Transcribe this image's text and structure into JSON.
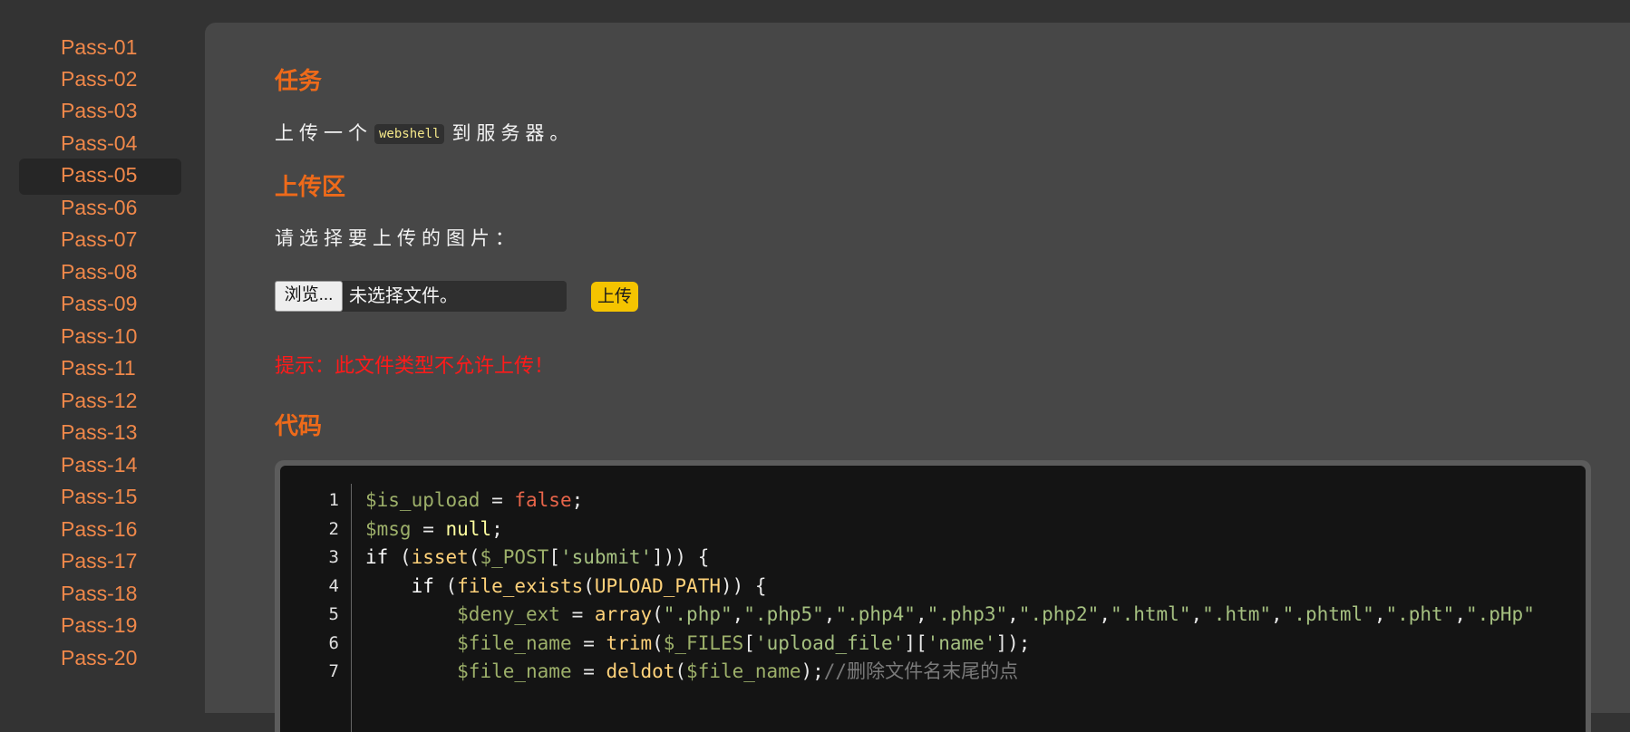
{
  "sidebar": {
    "items": [
      {
        "label": "Pass-01",
        "active": false
      },
      {
        "label": "Pass-02",
        "active": false
      },
      {
        "label": "Pass-03",
        "active": false
      },
      {
        "label": "Pass-04",
        "active": false
      },
      {
        "label": "Pass-05",
        "active": true
      },
      {
        "label": "Pass-06",
        "active": false
      },
      {
        "label": "Pass-07",
        "active": false
      },
      {
        "label": "Pass-08",
        "active": false
      },
      {
        "label": "Pass-09",
        "active": false
      },
      {
        "label": "Pass-10",
        "active": false
      },
      {
        "label": "Pass-11",
        "active": false
      },
      {
        "label": "Pass-12",
        "active": false
      },
      {
        "label": "Pass-13",
        "active": false
      },
      {
        "label": "Pass-14",
        "active": false
      },
      {
        "label": "Pass-15",
        "active": false
      },
      {
        "label": "Pass-16",
        "active": false
      },
      {
        "label": "Pass-17",
        "active": false
      },
      {
        "label": "Pass-18",
        "active": false
      },
      {
        "label": "Pass-19",
        "active": false
      },
      {
        "label": "Pass-20",
        "active": false
      }
    ]
  },
  "task": {
    "heading": "任务",
    "text_before": "上传一个",
    "code": "webshell",
    "text_after": "到服务器。"
  },
  "upload": {
    "heading": "上传区",
    "prompt": "请选择要上传的图片：",
    "browse_label": "浏览...",
    "file_status": "未选择文件。",
    "submit_label": "上传",
    "message": "提示：此文件类型不允许上传！"
  },
  "code": {
    "heading": "代码",
    "line_numbers": [
      "1",
      "2",
      "3",
      "4",
      "5",
      "6",
      "7"
    ],
    "lines": [
      [
        {
          "t": "$is_upload",
          "c": "v"
        },
        {
          "t": " = ",
          "c": "p"
        },
        {
          "t": "false",
          "c": "b"
        },
        {
          "t": ";",
          "c": "p"
        }
      ],
      [
        {
          "t": "$msg",
          "c": "v"
        },
        {
          "t": " = ",
          "c": "p"
        },
        {
          "t": "null",
          "c": "n"
        },
        {
          "t": ";",
          "c": "p"
        }
      ],
      [
        {
          "t": "if",
          "c": "k"
        },
        {
          "t": " (",
          "c": "p"
        },
        {
          "t": "isset",
          "c": "f"
        },
        {
          "t": "(",
          "c": "p"
        },
        {
          "t": "$_POST",
          "c": "v"
        },
        {
          "t": "[",
          "c": "p"
        },
        {
          "t": "'submit'",
          "c": "s"
        },
        {
          "t": "])) {",
          "c": "p"
        }
      ],
      [
        {
          "t": "    ",
          "c": "p"
        },
        {
          "t": "if",
          "c": "k"
        },
        {
          "t": " (",
          "c": "p"
        },
        {
          "t": "file_exists",
          "c": "f"
        },
        {
          "t": "(",
          "c": "p"
        },
        {
          "t": "UPLOAD_PATH",
          "c": "f"
        },
        {
          "t": ")) {",
          "c": "p"
        }
      ],
      [
        {
          "t": "        ",
          "c": "p"
        },
        {
          "t": "$deny_ext",
          "c": "v"
        },
        {
          "t": " = ",
          "c": "p"
        },
        {
          "t": "array",
          "c": "f"
        },
        {
          "t": "(",
          "c": "p"
        },
        {
          "t": "\".php\"",
          "c": "s"
        },
        {
          "t": ",",
          "c": "p"
        },
        {
          "t": "\".php5\"",
          "c": "s"
        },
        {
          "t": ",",
          "c": "p"
        },
        {
          "t": "\".php4\"",
          "c": "s"
        },
        {
          "t": ",",
          "c": "p"
        },
        {
          "t": "\".php3\"",
          "c": "s"
        },
        {
          "t": ",",
          "c": "p"
        },
        {
          "t": "\".php2\"",
          "c": "s"
        },
        {
          "t": ",",
          "c": "p"
        },
        {
          "t": "\".html\"",
          "c": "s"
        },
        {
          "t": ",",
          "c": "p"
        },
        {
          "t": "\".htm\"",
          "c": "s"
        },
        {
          "t": ",",
          "c": "p"
        },
        {
          "t": "\".phtml\"",
          "c": "s"
        },
        {
          "t": ",",
          "c": "p"
        },
        {
          "t": "\".pht\"",
          "c": "s"
        },
        {
          "t": ",",
          "c": "p"
        },
        {
          "t": "\".pHp\"",
          "c": "s"
        }
      ],
      [
        {
          "t": "        ",
          "c": "p"
        },
        {
          "t": "$file_name",
          "c": "v"
        },
        {
          "t": " = ",
          "c": "p"
        },
        {
          "t": "trim",
          "c": "f"
        },
        {
          "t": "(",
          "c": "p"
        },
        {
          "t": "$_FILES",
          "c": "v"
        },
        {
          "t": "[",
          "c": "p"
        },
        {
          "t": "'upload_file'",
          "c": "s"
        },
        {
          "t": "][",
          "c": "p"
        },
        {
          "t": "'name'",
          "c": "s"
        },
        {
          "t": "]);",
          "c": "p"
        }
      ],
      [
        {
          "t": "        ",
          "c": "p"
        },
        {
          "t": "$file_name",
          "c": "v"
        },
        {
          "t": " = ",
          "c": "p"
        },
        {
          "t": "deldot",
          "c": "f"
        },
        {
          "t": "(",
          "c": "p"
        },
        {
          "t": "$file_name",
          "c": "v"
        },
        {
          "t": ");",
          "c": "p"
        },
        {
          "t": "//删除文件名末尾的点",
          "c": "c"
        }
      ]
    ]
  },
  "colors": {
    "nav_text": "#f0884a",
    "heading": "#ee6a1a",
    "error": "#ff1a1a",
    "upload_button": "#f5c400"
  }
}
